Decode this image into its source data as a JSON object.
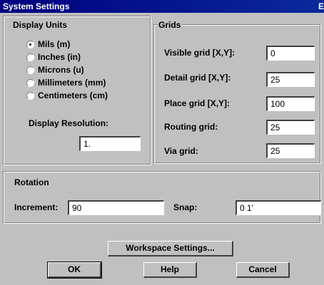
{
  "window": {
    "title": "System Settings",
    "close_glyph": "E"
  },
  "display_units": {
    "group_label": "Display Units",
    "options": [
      {
        "label": "Mils (m)",
        "checked": true
      },
      {
        "label": "Inches (in)",
        "checked": false
      },
      {
        "label": "Microns (u)",
        "checked": false
      },
      {
        "label": "Millimeters (mm)",
        "checked": false
      },
      {
        "label": "Centimeters (cm)",
        "checked": false
      }
    ],
    "resolution_label": "Display Resolution:",
    "resolution_value": "1."
  },
  "grids": {
    "group_label": "Grids",
    "rows": [
      {
        "label": "Visible grid [X,Y]:",
        "value": "0"
      },
      {
        "label": "Detail grid [X,Y]:",
        "value": "25"
      },
      {
        "label": "Place grid [X,Y]:",
        "value": "100"
      },
      {
        "label": "Routing grid:",
        "value": "25"
      },
      {
        "label": "Via grid:",
        "value": "25"
      }
    ]
  },
  "rotation": {
    "group_label": "Rotation",
    "increment_label": "Increment:",
    "increment_value": "90",
    "snap_label": "Snap:",
    "snap_value": "0 1'"
  },
  "buttons": {
    "workspace": "Workspace Settings...",
    "ok": "OK",
    "help": "Help",
    "cancel": "Cancel"
  },
  "colors": {
    "titlebar": "#000080",
    "dialog_face": "#c0c0c0"
  }
}
